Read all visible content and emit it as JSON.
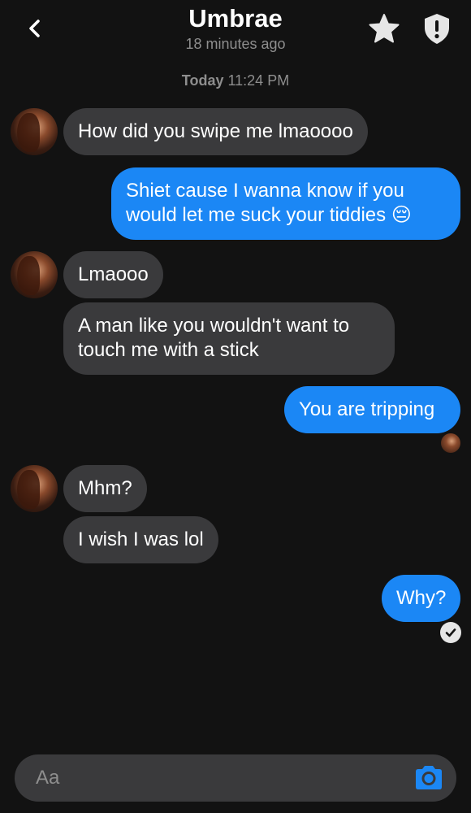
{
  "header": {
    "name": "Umbrae",
    "status": "18 minutes ago"
  },
  "conversation": {
    "timestamp_day": "Today",
    "timestamp_time": "11:24 PM",
    "messages": [
      {
        "from": "them",
        "text": "How did you swipe me lmaoooo"
      },
      {
        "from": "me",
        "line1": "Shiet cause I wanna know if you",
        "line2": "would let me suck your tiddies",
        "emoji": "😔"
      },
      {
        "from": "them",
        "text": "Lmaooo"
      },
      {
        "from": "them",
        "line1": "A man like you wouldn't want to",
        "line2": "touch me with a stick"
      },
      {
        "from": "me",
        "text": "You are tripping"
      },
      {
        "from": "them",
        "text": "Mhm?"
      },
      {
        "from": "them",
        "text": "I wish I was lol"
      },
      {
        "from": "me",
        "text": "Why?"
      }
    ]
  },
  "composer": {
    "placeholder": "Aa"
  },
  "colors": {
    "background": "#121212",
    "incoming_bubble": "#3a3a3c",
    "outgoing_bubble": "#1b87f5",
    "camera_accent": "#1b87f5"
  },
  "icons": {
    "back": "chevron-left-icon",
    "star": "star-icon",
    "shield": "shield-alert-icon",
    "camera": "camera-icon",
    "read": "check-icon"
  }
}
